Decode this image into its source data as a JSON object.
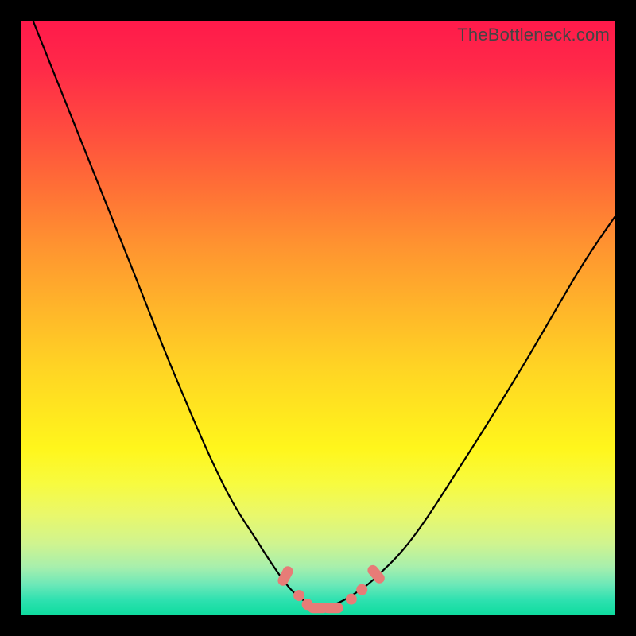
{
  "watermark": "TheBottleneck.com",
  "colors": {
    "frame": "#000000",
    "curve": "#000000",
    "bead": "#e77c77"
  },
  "chart_data": {
    "type": "line",
    "title": "",
    "xlabel": "",
    "ylabel": "",
    "xlim": [
      0,
      100
    ],
    "ylim": [
      0,
      100
    ],
    "grid": false,
    "note": "Axes are normalized percentages of the plot area; no numeric ticks are shown in the source image. Values are visual estimates.",
    "series": [
      {
        "name": "left-curve",
        "x": [
          2,
          10,
          18,
          26,
          34,
          40,
          44,
          46.5,
          48.5,
          50
        ],
        "y": [
          100,
          80,
          60,
          40,
          22,
          12,
          6,
          3.2,
          1.8,
          1.2
        ]
      },
      {
        "name": "right-curve",
        "x": [
          50,
          53,
          56,
          60,
          66,
          74,
          84,
          94,
          100
        ],
        "y": [
          1.2,
          1.8,
          3.4,
          6.5,
          13,
          25,
          41,
          58,
          67
        ]
      }
    ],
    "markers": {
      "name": "beads",
      "description": "Salmon-colored marker cluster along the valley bottom",
      "points": [
        {
          "x": 44.5,
          "y": 6.5,
          "shape": "pill",
          "angle": -62
        },
        {
          "x": 46.8,
          "y": 3.2,
          "shape": "circle"
        },
        {
          "x": 48.2,
          "y": 1.7,
          "shape": "circle"
        },
        {
          "x": 50.0,
          "y": 1.1,
          "shape": "pill",
          "angle": 0
        },
        {
          "x": 52.5,
          "y": 1.1,
          "shape": "pill",
          "angle": 0
        },
        {
          "x": 55.6,
          "y": 2.6,
          "shape": "circle"
        },
        {
          "x": 57.4,
          "y": 4.2,
          "shape": "circle"
        },
        {
          "x": 59.8,
          "y": 6.8,
          "shape": "pill",
          "angle": 50
        }
      ]
    }
  }
}
